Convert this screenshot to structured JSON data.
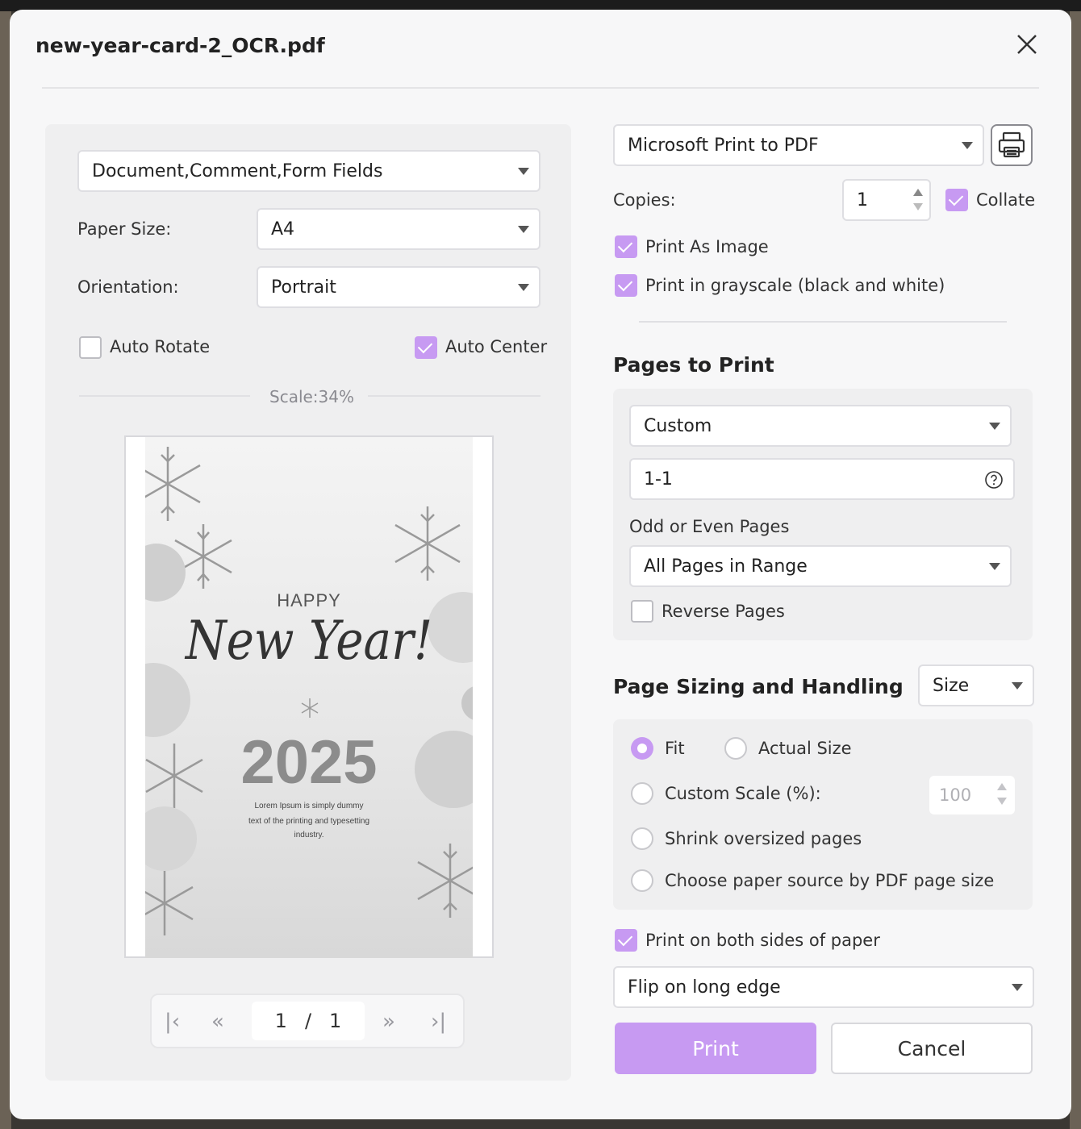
{
  "dialog": {
    "title": "new-year-card-2_OCR.pdf"
  },
  "left": {
    "content_select": "Document,Comment,Form Fields",
    "paper_size_label": "Paper Size:",
    "paper_size_value": "A4",
    "orientation_label": "Orientation:",
    "orientation_value": "Portrait",
    "auto_rotate": {
      "label": "Auto Rotate",
      "checked": false
    },
    "auto_center": {
      "label": "Auto Center",
      "checked": true
    },
    "scale_text": "Scale:34%",
    "preview": {
      "happy": "HAPPY",
      "new_year": "New Year!",
      "year": "2025",
      "lorem_1": "Lorem Ipsum is simply dummy",
      "lorem_2": "text of the printing and typesetting",
      "lorem_3": "industry."
    },
    "pager": {
      "current": "1",
      "separator": "/",
      "total": "1"
    }
  },
  "right": {
    "printer": "Microsoft Print to PDF",
    "copies_label": "Copies:",
    "copies_value": "1",
    "collate": {
      "label": "Collate",
      "checked": true
    },
    "print_as_image": {
      "label": "Print As Image",
      "checked": true
    },
    "grayscale": {
      "label": "Print in grayscale (black and white)",
      "checked": true
    },
    "pages_to_print": {
      "heading": "Pages to Print",
      "mode": "Custom",
      "range": "1-1",
      "odd_even_label": "Odd or Even Pages",
      "odd_even_value": "All Pages in Range",
      "reverse": {
        "label": "Reverse Pages",
        "checked": false
      }
    },
    "sizing": {
      "heading": "Page Sizing and Handling",
      "mode": "Size",
      "fit": "Fit",
      "actual_size": "Actual Size",
      "custom_scale": "Custom Scale (%):",
      "custom_scale_value": "100",
      "shrink": "Shrink oversized pages",
      "paper_source": "Choose paper source by PDF page size",
      "selected": "Fit"
    },
    "duplex": {
      "label": "Print on both sides of paper",
      "checked": true,
      "value": "Flip on long edge"
    },
    "print_button": "Print",
    "cancel_button": "Cancel"
  },
  "colors": {
    "accent": "#c79af2"
  }
}
